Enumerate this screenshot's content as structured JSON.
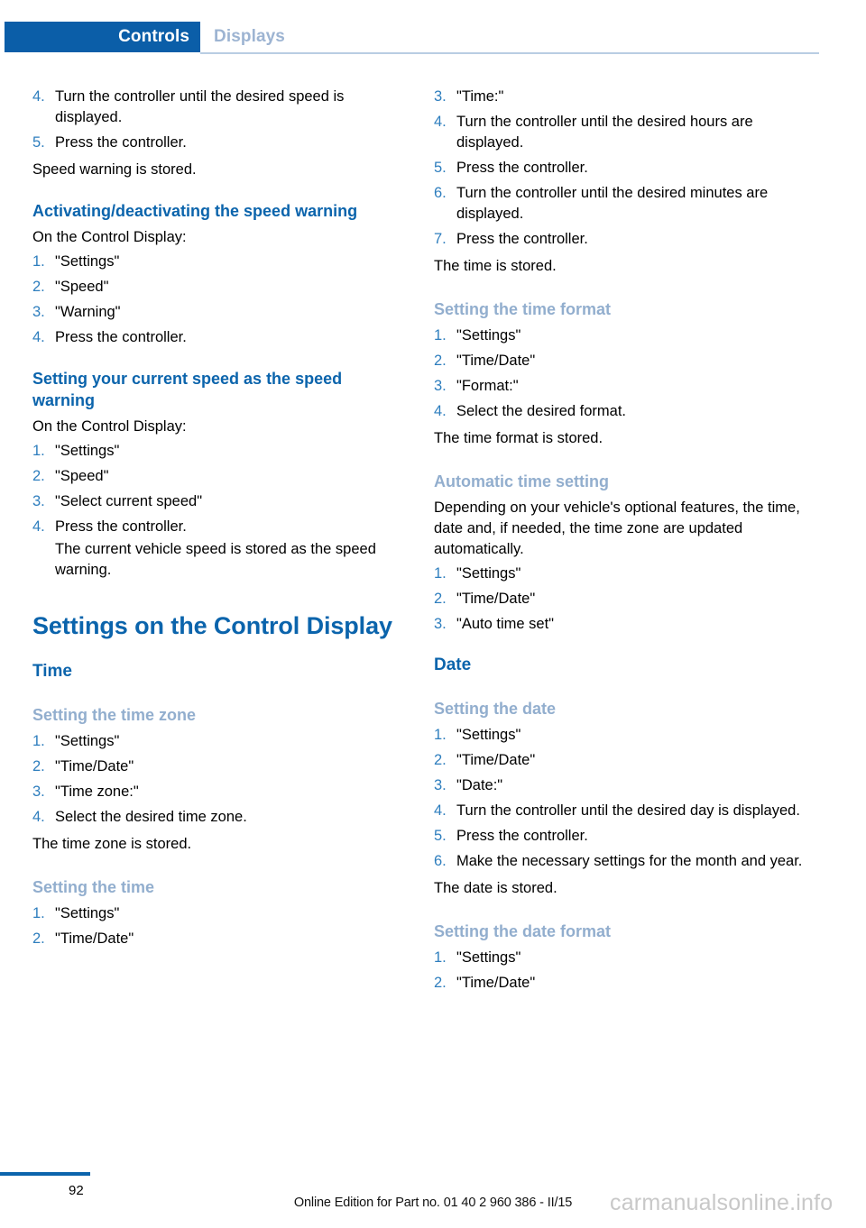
{
  "header": {
    "active_tab": "Controls",
    "inactive_tab": "Displays"
  },
  "colors": {
    "tab_active_bg": "#0b5ea8",
    "tab_active_text": "#ffffff",
    "tab_inactive_text": "#9db4d2",
    "heading_blue": "#0b64ac",
    "subheading_blue": "#92aece",
    "list_number_blue": "#2e7ebe",
    "body_text": "#000000",
    "rule_blue": "#b9cde3",
    "watermark_gray": "#c8c8c8"
  },
  "left_column": {
    "continued_steps": [
      {
        "num": "4.",
        "text": "Turn the controller until the desired speed is displayed."
      },
      {
        "num": "5.",
        "text": "Press the controller."
      }
    ],
    "result_1": "Speed warning is stored.",
    "section_activating": {
      "heading": "Activating/deactivating the speed warning",
      "intro": "On the Control Display:",
      "steps": [
        {
          "num": "1.",
          "text": "\"Settings\""
        },
        {
          "num": "2.",
          "text": "\"Speed\""
        },
        {
          "num": "3.",
          "text": "\"Warning\""
        },
        {
          "num": "4.",
          "text": "Press the controller."
        }
      ]
    },
    "section_current_speed": {
      "heading": "Setting your current speed as the speed warning",
      "intro": "On the Control Display:",
      "steps": [
        {
          "num": "1.",
          "text": "\"Settings\""
        },
        {
          "num": "2.",
          "text": "\"Speed\""
        },
        {
          "num": "3.",
          "text": "\"Select current speed\""
        },
        {
          "num": "4.",
          "text": "Press the controller.",
          "sub": "The current vehicle speed is stored as the speed warning."
        }
      ]
    },
    "chapter_title": "Settings on the Control Display",
    "section_time": {
      "heading": "Time",
      "time_zone": {
        "heading": "Setting the time zone",
        "steps": [
          {
            "num": "1.",
            "text": "\"Settings\""
          },
          {
            "num": "2.",
            "text": "\"Time/Date\""
          },
          {
            "num": "3.",
            "text": "\"Time zone:\""
          },
          {
            "num": "4.",
            "text": "Select the desired time zone."
          }
        ],
        "result": "The time zone is stored."
      },
      "setting_time": {
        "heading": "Setting the time",
        "steps": [
          {
            "num": "1.",
            "text": "\"Settings\""
          },
          {
            "num": "2.",
            "text": "\"Time/Date\""
          }
        ]
      }
    }
  },
  "right_column": {
    "continued_steps": [
      {
        "num": "3.",
        "text": "\"Time:\""
      },
      {
        "num": "4.",
        "text": "Turn the controller until the desired hours are displayed."
      },
      {
        "num": "5.",
        "text": "Press the controller."
      },
      {
        "num": "6.",
        "text": "Turn the controller until the desired minutes are displayed."
      },
      {
        "num": "7.",
        "text": "Press the controller."
      }
    ],
    "result_1": "The time is stored.",
    "time_format": {
      "heading": "Setting the time format",
      "steps": [
        {
          "num": "1.",
          "text": "\"Settings\""
        },
        {
          "num": "2.",
          "text": "\"Time/Date\""
        },
        {
          "num": "3.",
          "text": "\"Format:\""
        },
        {
          "num": "4.",
          "text": "Select the desired format."
        }
      ],
      "result": "The time format is stored."
    },
    "auto_time": {
      "heading": "Automatic time setting",
      "intro": "Depending on your vehicle's optional features, the time, date and, if needed, the time zone are updated automatically.",
      "steps": [
        {
          "num": "1.",
          "text": "\"Settings\""
        },
        {
          "num": "2.",
          "text": "\"Time/Date\""
        },
        {
          "num": "3.",
          "text": "\"Auto time set\""
        }
      ]
    },
    "date_section": {
      "heading": "Date",
      "setting_date": {
        "heading": "Setting the date",
        "steps": [
          {
            "num": "1.",
            "text": "\"Settings\""
          },
          {
            "num": "2.",
            "text": "\"Time/Date\""
          },
          {
            "num": "3.",
            "text": "\"Date:\""
          },
          {
            "num": "4.",
            "text": "Turn the controller until the desired day is displayed."
          },
          {
            "num": "5.",
            "text": "Press the controller."
          },
          {
            "num": "6.",
            "text": "Make the necessary settings for the month and year."
          }
        ],
        "result": "The date is stored."
      },
      "date_format": {
        "heading": "Setting the date format",
        "steps": [
          {
            "num": "1.",
            "text": "\"Settings\""
          },
          {
            "num": "2.",
            "text": "\"Time/Date\""
          }
        ]
      }
    }
  },
  "footer": {
    "page_number": "92",
    "edition_note": "Online Edition for Part no. 01 40 2 960 386 - II/15",
    "watermark": "carmanualsonline.info"
  }
}
